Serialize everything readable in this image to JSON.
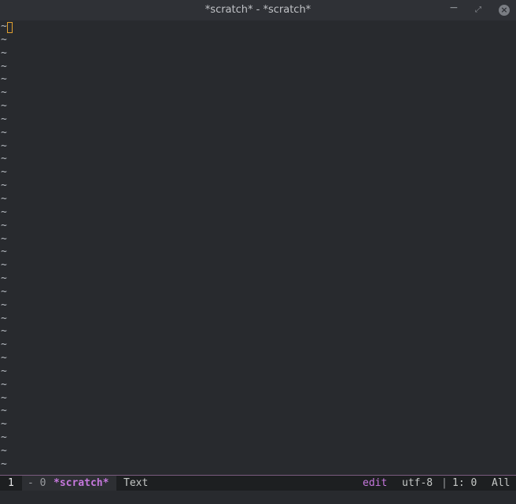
{
  "window": {
    "title": "*scratch* - *scratch*",
    "controls": {
      "minimize": "−",
      "maximize": "⤢",
      "close": "×"
    }
  },
  "editor": {
    "empty_line_marker": "~",
    "visible_empty_lines": 34
  },
  "modeline": {
    "window_number": "1",
    "state": "- 0",
    "buffer_name": "*scratch*",
    "major_mode": "Text",
    "evil_state": "edit",
    "encoding": "utf-8",
    "separator": "|",
    "position": "1: 0",
    "scroll": "All"
  },
  "colors": {
    "background": "#282a2e",
    "titlebar": "#2f3136",
    "cursor": "#e0a030",
    "accent": "#c678dd",
    "modeline_bg": "#1d1f21"
  }
}
